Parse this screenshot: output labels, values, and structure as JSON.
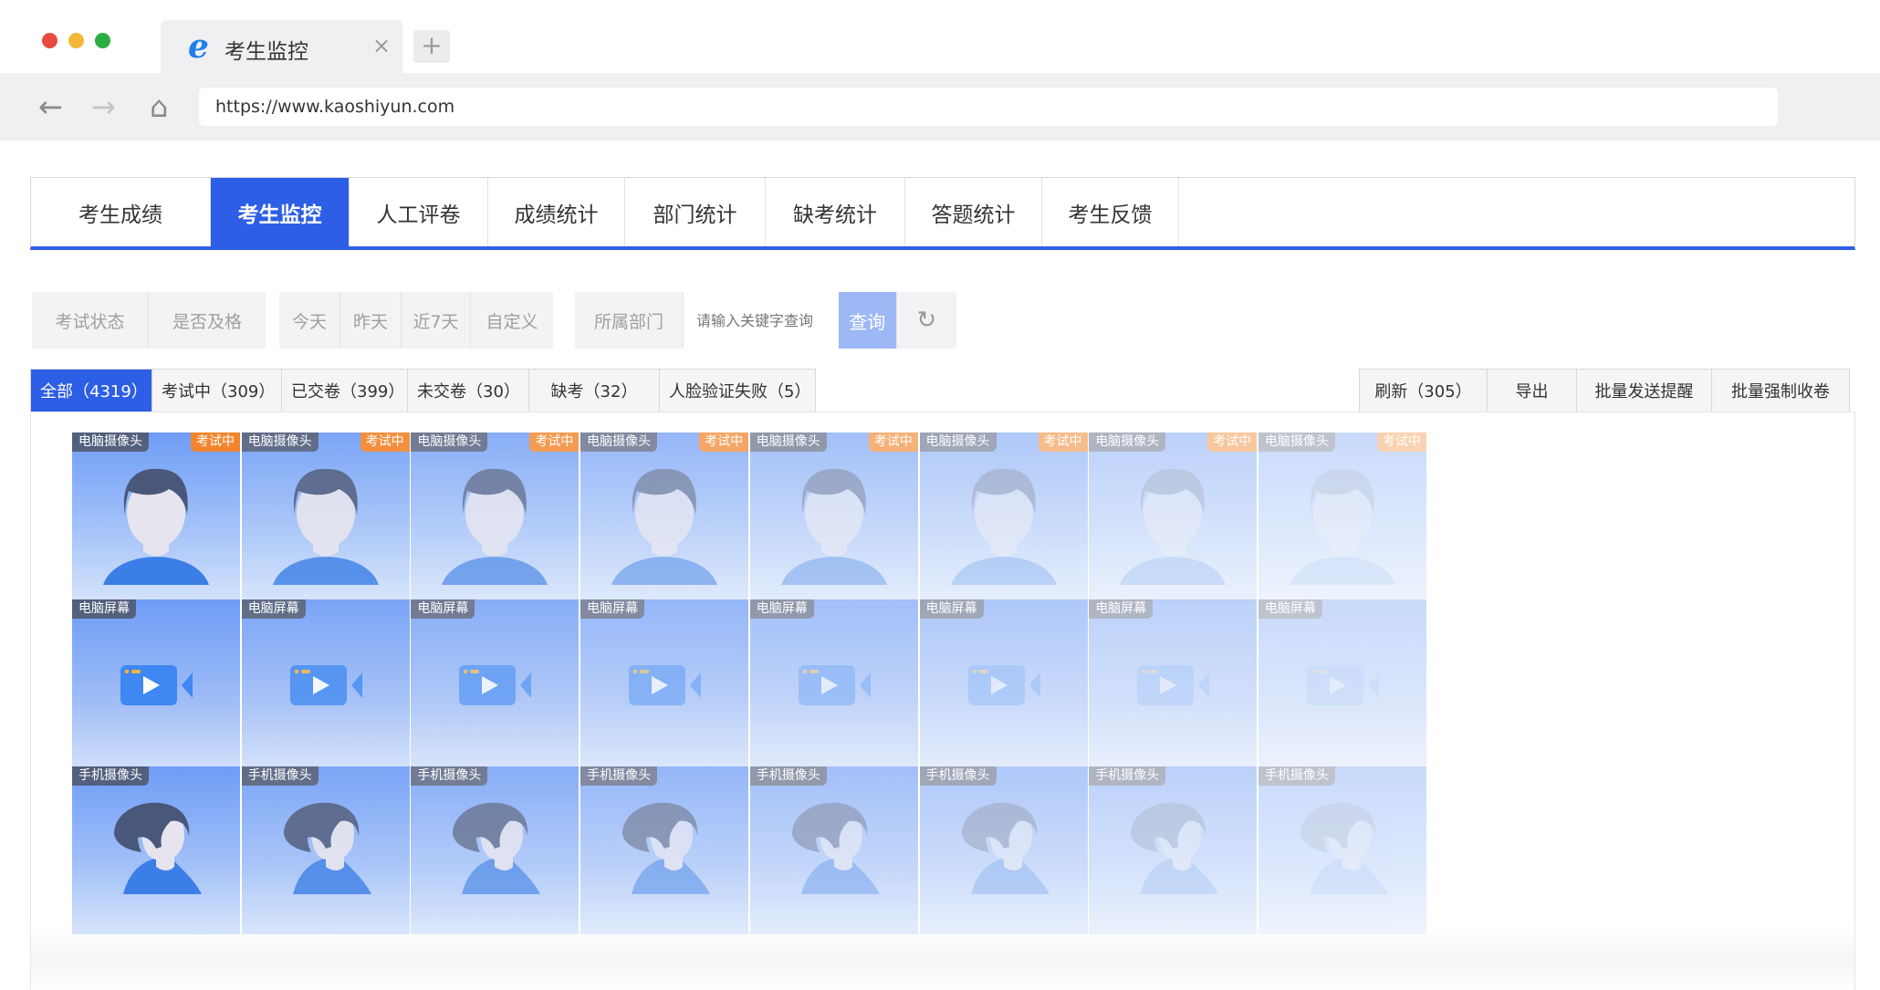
{
  "browser": {
    "tab_title": "考生监控",
    "tab_close": "×",
    "new_tab": "+",
    "url": "https://www.kaoshiyun.com",
    "nav_back": "←",
    "nav_forward": "→",
    "nav_home": "⌂"
  },
  "main_tabs": [
    {
      "label": "考生成绩",
      "active": false
    },
    {
      "label": "考生监控",
      "active": true
    },
    {
      "label": "人工评卷",
      "active": false
    },
    {
      "label": "成绩统计",
      "active": false
    },
    {
      "label": "部门统计",
      "active": false
    },
    {
      "label": "缺考统计",
      "active": false
    },
    {
      "label": "答题统计",
      "active": false
    },
    {
      "label": "考生反馈",
      "active": false
    }
  ],
  "filters": {
    "status_filters": [
      "考试状态",
      "是否及格"
    ],
    "date_filters": [
      "今天",
      "昨天",
      "近7天",
      "自定义"
    ],
    "department": "所属部门",
    "keyword_placeholder": "请输入关键字查询",
    "query_button": "查询",
    "reset_icon": "↻"
  },
  "status_tabs": [
    {
      "label": "全部（4319）",
      "active": true
    },
    {
      "label": "考试中（309）",
      "active": false
    },
    {
      "label": "已交卷（399）",
      "active": false
    },
    {
      "label": "未交卷（30）",
      "active": false
    },
    {
      "label": "缺考（32）",
      "active": false
    },
    {
      "label": "人脸验证失败（5）",
      "active": false
    }
  ],
  "actions": [
    "刷新（305）",
    "导出",
    "批量发送提醒",
    "批量强制收卷"
  ],
  "monitor": {
    "labels": {
      "pc_camera": "电脑摄像头",
      "pc_screen": "电脑屏幕",
      "phone_camera": "手机摄像头",
      "status_badge": "考试中"
    },
    "candidate_count": 8
  },
  "colors": {
    "primary": "#2d5ee6",
    "badge": "#f2862e",
    "tile": "#6e9cf6"
  }
}
